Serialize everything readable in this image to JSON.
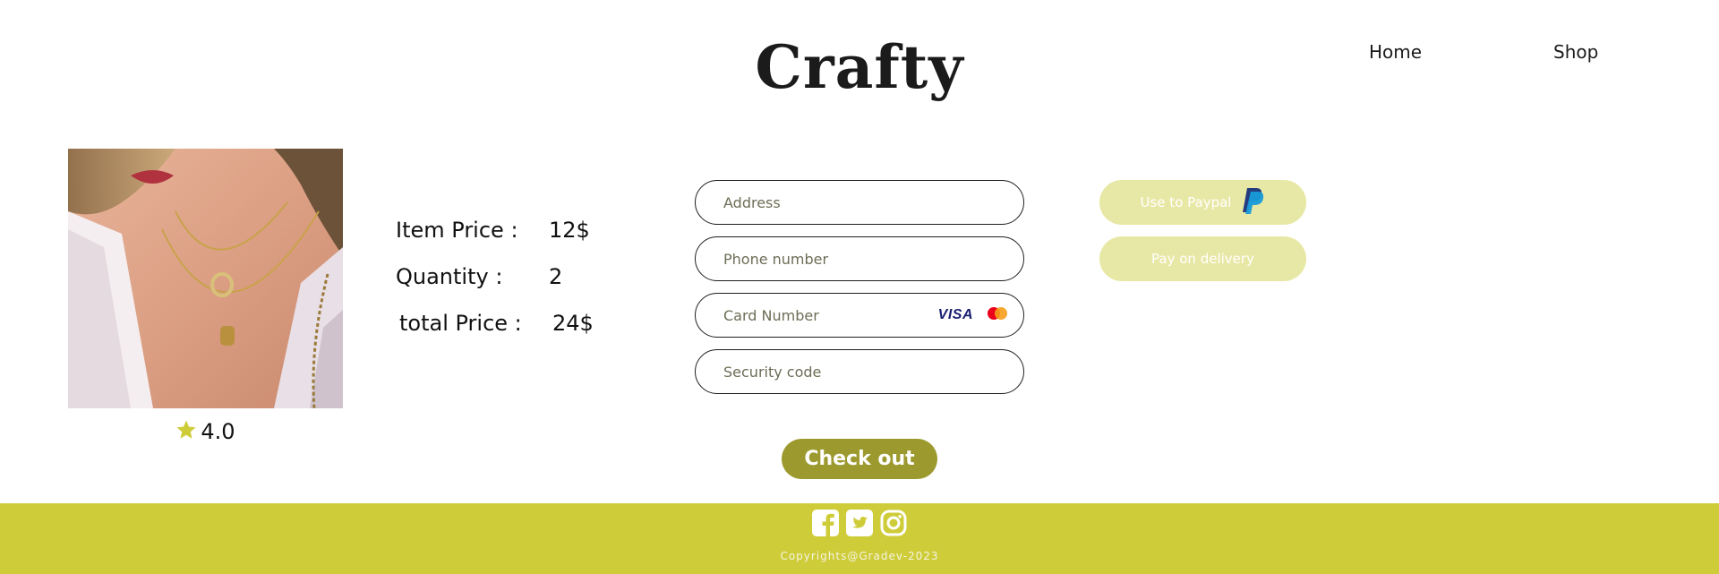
{
  "header": {
    "brand": "Crafty",
    "nav": [
      {
        "label": "Home"
      },
      {
        "label": "Shop"
      }
    ]
  },
  "product": {
    "image_icon": "necklace-photo",
    "rating": "4.0",
    "rating_icon": "star-icon",
    "star_color": "#cfcc3a"
  },
  "pricing": {
    "item_price_label": "Item Price :",
    "item_price_value": "12$",
    "quantity_label": "Quantity :",
    "quantity_value": "2",
    "total_label": "total Price :",
    "total_value": "24$"
  },
  "form": {
    "address_placeholder": "Address",
    "phone_placeholder": "Phone number",
    "card_placeholder": "Card Number",
    "security_placeholder": "Security code",
    "visa_label": "VISA",
    "mastercard_icon": "mastercard-icon"
  },
  "payment": {
    "paypal_label": "Use to Paypal",
    "paypal_icon": "paypal-icon",
    "delivery_label": "Pay on delivery",
    "button_color": "#e8e8a6"
  },
  "checkout": {
    "label": "Check out",
    "color": "#9c9a2e"
  },
  "footer": {
    "background": "#cfcc3a",
    "social_icons": [
      "facebook-icon",
      "twitter-icon",
      "instagram-icon"
    ],
    "copyright": "Copyrights@Gradev-2023"
  }
}
